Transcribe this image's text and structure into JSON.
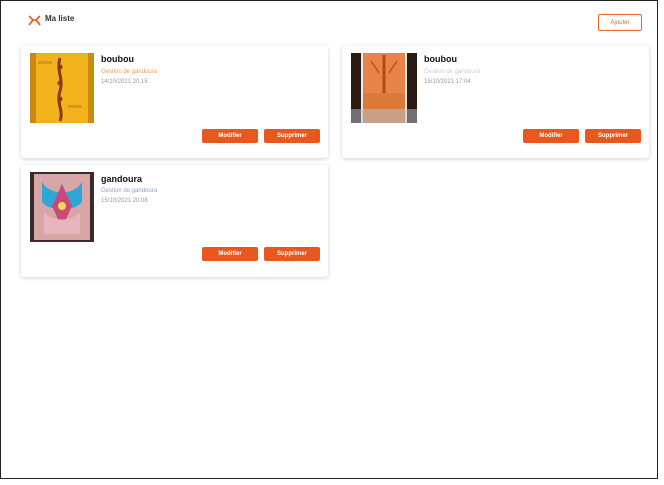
{
  "header": {
    "brand": "Ma liste",
    "top_button": "Ajouter"
  },
  "items": [
    {
      "name": "boubou",
      "meta1": "Gestion de gandoura",
      "meta2": "14/10/2021 20:15",
      "action1": "Modifier",
      "action2": "Supprimer"
    },
    {
      "name": "boubou",
      "meta1": "Gestion de gandoura",
      "meta2": "15/10/2021 17:04",
      "action1": "Modifier",
      "action2": "Supprimer"
    },
    {
      "name": "gandoura",
      "meta1": "Gestion de gandoura",
      "meta2": "15/10/2021 20:08",
      "action1": "Modifier",
      "action2": "Supprimer"
    }
  ],
  "colors": {
    "accent": "#e8571e",
    "outline": "#e8682b"
  }
}
